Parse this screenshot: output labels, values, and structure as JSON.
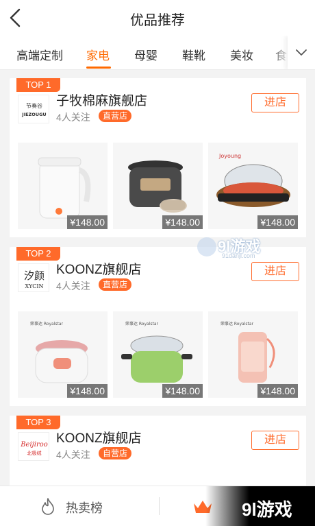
{
  "header": {
    "title": "优品推荐"
  },
  "tabs": [
    {
      "label": "高端定制",
      "active": false
    },
    {
      "label": "家电",
      "active": true
    },
    {
      "label": "母婴",
      "active": false
    },
    {
      "label": "鞋靴",
      "active": false
    },
    {
      "label": "美妆",
      "active": false
    },
    {
      "label": "食",
      "active": false
    }
  ],
  "stores": [
    {
      "rank": "TOP 1",
      "logo_text": "JIEZOUGU",
      "logo_cn": "节奏谷",
      "name": "子牧棉麻旗舰店",
      "followers": "4人关注",
      "tag": "直营店",
      "enter_label": "进店",
      "products": [
        {
          "icon": "kettle-icon",
          "price": "¥148.00"
        },
        {
          "icon": "pressure-cooker-icon",
          "price": "¥148.00"
        },
        {
          "icon": "hot-pot-icon",
          "price": "¥148.00"
        }
      ]
    },
    {
      "rank": "TOP 2",
      "logo_text": "XYCIN",
      "logo_cn": "汐颜",
      "name": "KOONZ旗舰店",
      "followers": "4人关注",
      "tag": "直营店",
      "enter_label": "进店",
      "products": [
        {
          "icon": "rice-cooker-icon",
          "price": "¥148.00"
        },
        {
          "icon": "electric-pot-icon",
          "price": "¥148.00"
        },
        {
          "icon": "juicer-cup-icon",
          "price": "¥148.00"
        }
      ]
    },
    {
      "rank": "TOP 3",
      "logo_text": "Beijiroo",
      "logo_cn": "北极绒",
      "name": "KOONZ旗舰店",
      "followers": "4人关注",
      "tag": "自营店",
      "enter_label": "进店"
    }
  ],
  "bottom_bar": {
    "hot_label": "热卖榜"
  },
  "watermark": {
    "text": "9l游戏",
    "center_text": "9l游戏",
    "center_sub": "91danji.com"
  },
  "colors": {
    "accent": "#ff6a00",
    "badge": "#ff6a2a"
  }
}
